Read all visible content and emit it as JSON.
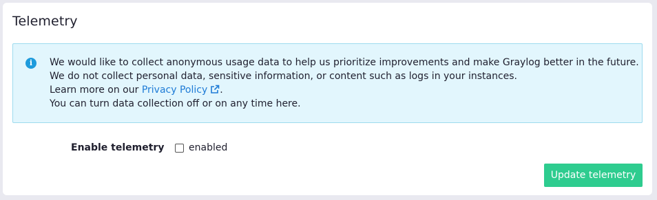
{
  "panel": {
    "title": "Telemetry"
  },
  "info": {
    "icon": "info-circle-icon",
    "line1": "We would like to collect anonymous usage data to help us prioritize improvements and make Graylog better in the future.",
    "line2": "We do not collect personal data, sensitive information, or content such as logs in your instances.",
    "line3_prefix": "Learn more on our ",
    "privacy_link": "Privacy Policy",
    "line3_suffix": ".",
    "line4": "You can turn data collection off or on any time here.",
    "accent_color": "#1e9bdc",
    "background_color": "#e2f6fd"
  },
  "form": {
    "label": "Enable telemetry",
    "checkbox_label": "enabled",
    "checked": false
  },
  "actions": {
    "update_label": "Update telemetry",
    "update_color": "#2ecc8f"
  }
}
